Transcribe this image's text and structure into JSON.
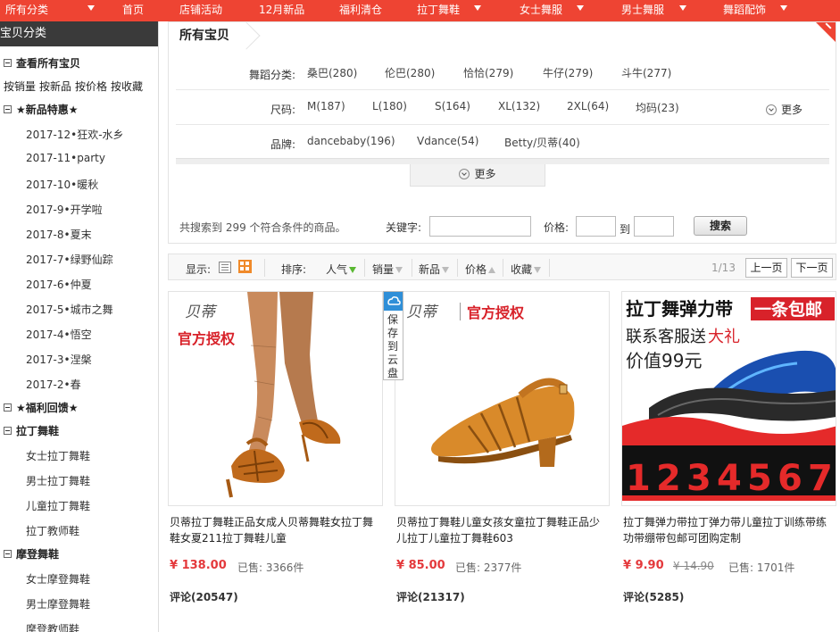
{
  "nav": {
    "items": [
      {
        "label": "所有分类",
        "caret": true
      },
      {
        "label": "首页",
        "caret": false
      },
      {
        "label": "店铺活动",
        "caret": false
      },
      {
        "label": "12月新品",
        "caret": false
      },
      {
        "label": "福利清仓",
        "caret": false
      },
      {
        "label": "拉丁舞鞋",
        "caret": true
      },
      {
        "label": "女士舞服",
        "caret": true
      },
      {
        "label": "男士舞服",
        "caret": true
      },
      {
        "label": "舞蹈配饰",
        "caret": true
      }
    ]
  },
  "sidebar": {
    "header": "宝贝分类",
    "view_all": "查看所有宝贝",
    "sorts": [
      "按销量",
      "按新品",
      "按价格",
      "按收藏"
    ],
    "new_title": "★新品特惠★",
    "new_items": [
      "2017-12•狂欢-水乡",
      "2017-11•party",
      "2017-10•暖秋",
      "2017-9•开学啦",
      "2017-8•夏末",
      "2017-7•绿野仙踪",
      "2017-6•仲夏",
      "2017-5•城市之舞",
      "2017-4•悟空",
      "2017-3•涅槃",
      "2017-2•春"
    ],
    "welfare_title": "★福利回馈★",
    "latin_title": "拉丁舞鞋",
    "latin_items": [
      "女士拉丁舞鞋",
      "男士拉丁舞鞋",
      "儿童拉丁舞鞋",
      "拉丁教师鞋"
    ],
    "modern_title": "摩登舞鞋",
    "modern_items": [
      "女士摩登舞鞋",
      "男士摩登舞鞋",
      "摩登教师鞋"
    ]
  },
  "filter": {
    "title": "所有宝贝",
    "rows": [
      {
        "label": "舞蹈分类:",
        "values": [
          "桑巴(280)",
          "伦巴(280)",
          "恰恰(279)",
          "牛仔(279)",
          "斗牛(277)"
        ]
      },
      {
        "label": "尺码:",
        "values": [
          "M(187)",
          "L(180)",
          "S(164)",
          "XL(132)",
          "2XL(64)",
          "均码(23)"
        ],
        "more": "更多"
      },
      {
        "label": "品牌:",
        "values": [
          "dancebaby(196)",
          "Vdance(54)",
          "Betty/贝蒂(40)"
        ]
      }
    ],
    "more_toggle": "更多",
    "result_text": "共搜索到 299 个符合条件的商品。",
    "keyword_label": "关键字:",
    "keyword_value": "",
    "price_label": "价格:",
    "price_to": "到",
    "price_min": "",
    "price_max": "",
    "search_button": "搜索"
  },
  "sortbar": {
    "display_label": "显示:",
    "sort_label": "排序:",
    "sorts": [
      "人气",
      "销量",
      "新品",
      "价格",
      "收藏"
    ],
    "page_indicator": "1/13",
    "prev": "上一页",
    "next": "下一页"
  },
  "save_tab": "保存到云盘",
  "products": [
    {
      "brand": "贝蒂",
      "badge": "官方授权",
      "title": "贝蒂拉丁舞鞋正品女成人贝蒂舞鞋女拉丁舞鞋女夏211拉丁舞鞋儿童",
      "price": "¥ 138.00",
      "old_price": "",
      "sold": "已售: 3366件",
      "comments": "评论(20547)"
    },
    {
      "brand": "贝蒂",
      "badge": "官方授权",
      "title": "贝蒂拉丁舞鞋儿童女孩女童拉丁舞鞋正品少儿拉丁儿童拉丁舞鞋603",
      "price": "¥ 85.00",
      "old_price": "",
      "sold": "已售: 2377件",
      "comments": "评论(21317)"
    },
    {
      "banner_line1": "拉丁舞弹力带",
      "banner_tag": "一条包邮",
      "banner_line2a": "联系客服送",
      "banner_line2b": "大礼",
      "banner_line3": "价值99元",
      "banner_numbers": [
        "1",
        "2",
        "3",
        "4",
        "5",
        "6",
        "7"
      ],
      "title": "拉丁舞弹力带拉丁弹力带儿童拉丁训练带练功带绷带包邮可团购定制",
      "price": "¥ 9.90",
      "old_price": "¥ 14.90",
      "sold": "已售: 1701件",
      "comments": "评论(5285)"
    }
  ],
  "colors": {
    "nav_bg": "#ee4433",
    "price": "#e4393c",
    "sidebar_header": "#3a3a3a"
  }
}
